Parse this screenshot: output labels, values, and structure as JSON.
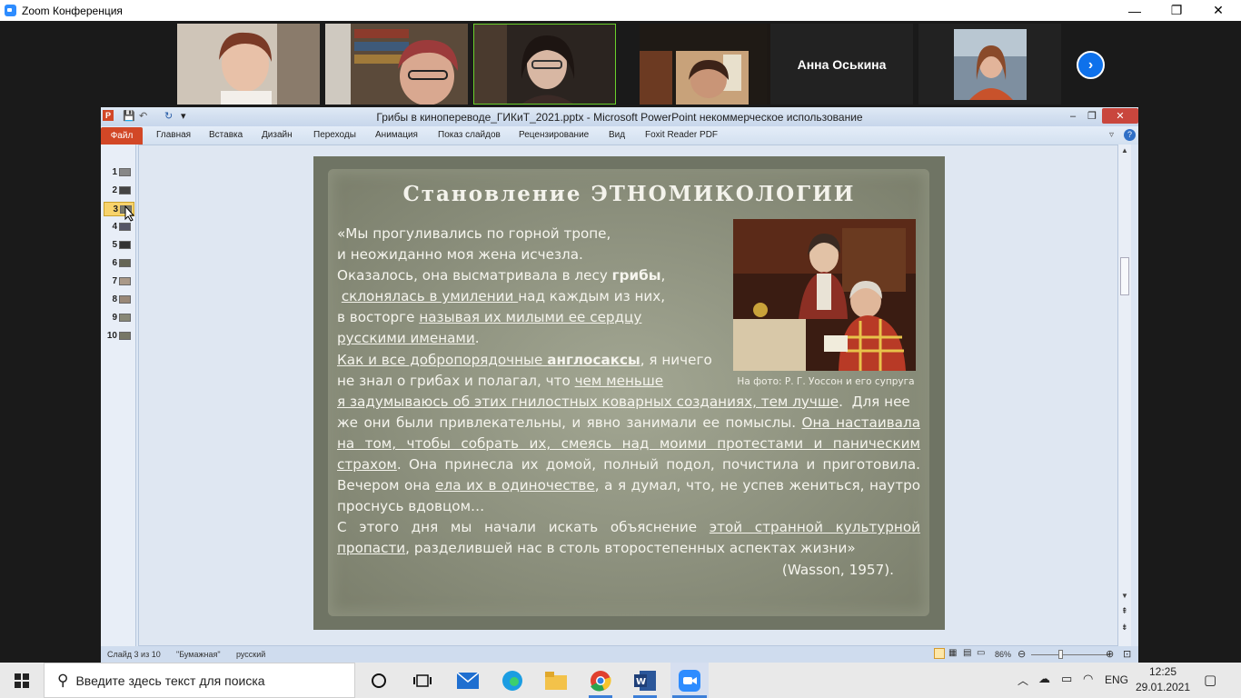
{
  "zoom": {
    "title": "Zoom Конференция",
    "controls": {
      "minimize": "—",
      "maximize": "❐",
      "close": "✕"
    },
    "participant_name": "Анна Оськина",
    "next_icon": "›"
  },
  "ppt": {
    "title": "Грибы в кинопереводе_ГИКиТ_2021.pptx - Microsoft PowerPoint некоммерческое использование",
    "tabs": {
      "file": "Файл",
      "home": "Главная",
      "insert": "Вставка",
      "design": "Дизайн",
      "transitions": "Переходы",
      "animations": "Анимация",
      "slideshow": "Показ слайдов",
      "review": "Рецензирование",
      "view": "Вид",
      "foxit": "Foxit Reader PDF"
    },
    "slides": [
      "1",
      "2",
      "3",
      "4",
      "5",
      "6",
      "7",
      "8",
      "9",
      "10"
    ],
    "selected_slide": 3,
    "status": {
      "slide": "Слайд 3 из 10",
      "theme": "\"Бумажная\"",
      "lang": "русский",
      "zoom": "86%"
    }
  },
  "slide": {
    "title": "Становление ЭТНОМИКОЛОГИИ",
    "caption": "На фото: Р. Г. Уоссон и его супруга",
    "citation": "(Wasson, 1957)."
  },
  "taskbar": {
    "search_placeholder": "Введите здесь текст для поиска",
    "lang": "ENG",
    "time": "12:25",
    "date": "29.01.2021"
  },
  "colors": {
    "zoom_blue": "#0e71eb",
    "ppt_file_tab": "#d24726",
    "slide_bg": "#8c907d"
  }
}
